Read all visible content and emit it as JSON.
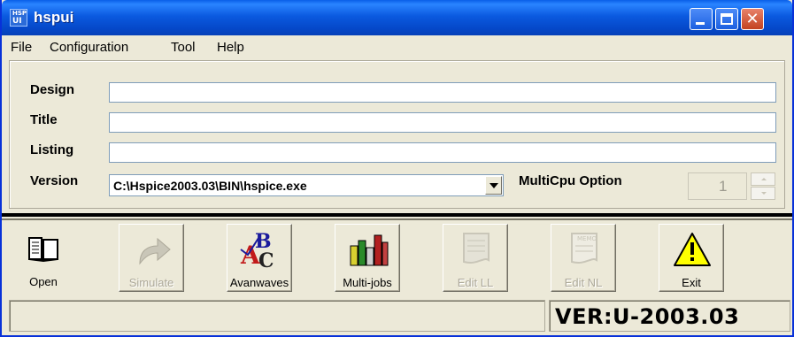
{
  "window": {
    "title": "hspui",
    "icon_text_top": "HSP",
    "icon_text_bottom": "UI",
    "controls": [
      "minimize-icon",
      "maximize-icon",
      "close-icon"
    ]
  },
  "menu": {
    "items": [
      "File",
      "Configuration",
      "Tool",
      "Help"
    ]
  },
  "form": {
    "design_label": "Design",
    "design_value": "",
    "title_label": "Title",
    "title_value": "",
    "listing_label": "Listing",
    "listing_value": "",
    "version_label": "Version",
    "version_value": "C:\\Hspice2003.03\\BIN\\hspice.exe",
    "multicpu_label": "MultiCpu Option",
    "multicpu_value": "1"
  },
  "toolbar": {
    "buttons": [
      {
        "label": "Open",
        "icon": "open-book-icon",
        "enabled": true
      },
      {
        "label": "Simulate",
        "icon": "arrow-icon",
        "enabled": false
      },
      {
        "label": "Avanwaves",
        "icon": "abc-spellcheck-icon",
        "enabled": true
      },
      {
        "label": "Multi-jobs",
        "icon": "bottles-icon",
        "enabled": true
      },
      {
        "label": "Edit LL",
        "icon": "document-icon",
        "enabled": false
      },
      {
        "label": "Edit NL",
        "icon": "memo-icon",
        "enabled": false
      },
      {
        "label": "Exit",
        "icon": "warning-icon",
        "enabled": true
      }
    ],
    "memo_text": "MEMO"
  },
  "status": {
    "left_text": "",
    "version_text": "VER:U-2003.03"
  },
  "colors": {
    "titlebar": "#0548c9",
    "window_bg": "#ece9d8",
    "close_button": "#c3421f"
  }
}
